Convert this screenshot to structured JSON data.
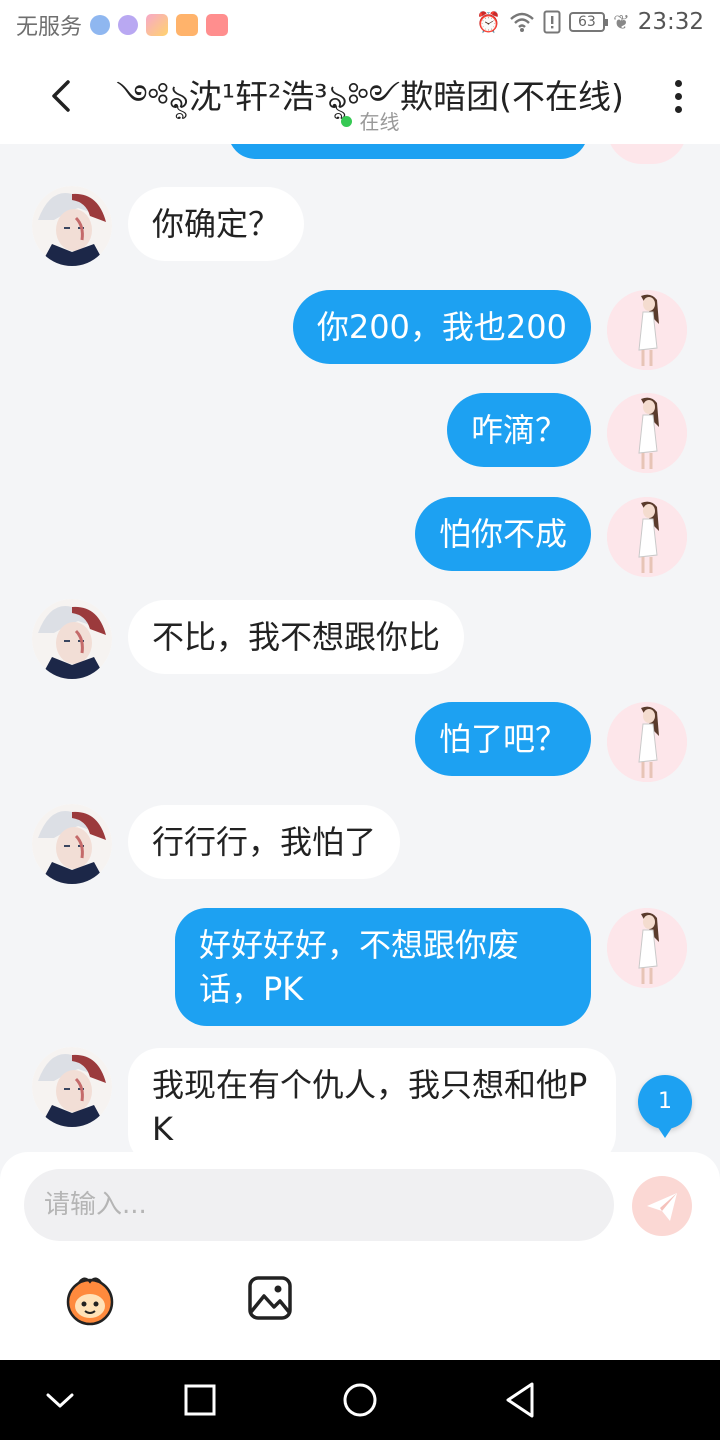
{
  "status_bar": {
    "carrier": "无服务",
    "battery": "63",
    "time": "23:32"
  },
  "header": {
    "title": "༺ৡ沈¹轩²浩³ৡ༻欺暗团(不在线)",
    "presence": "在线"
  },
  "messages": [
    {
      "side": "left",
      "text": "你确定？"
    },
    {
      "side": "right",
      "text": "你200，我也200"
    },
    {
      "side": "right",
      "text": "咋滴？"
    },
    {
      "side": "right",
      "text": "怕你不成"
    },
    {
      "side": "left",
      "text": "不比，我不想跟你比"
    },
    {
      "side": "right",
      "text": "怕了吧？"
    },
    {
      "side": "left",
      "text": "行行行，我怕了"
    },
    {
      "side": "right",
      "text": "好好好好，不想跟你废话，PK"
    },
    {
      "side": "left",
      "text": "我现在有个仇人，我只想和他PK"
    }
  ],
  "unread_count": "1",
  "input": {
    "placeholder": "请输入..."
  },
  "icons": {
    "back": "back-arrow-icon",
    "more": "more-vertical-icon",
    "send": "send-icon",
    "emoji": "emoji-icon",
    "image": "image-icon"
  },
  "colors": {
    "outgoing_bubble": "#1da1f2",
    "incoming_bubble": "#ffffff",
    "background": "#f4f5f7",
    "online_dot": "#36c954",
    "send_button": "#fbd8d4"
  }
}
